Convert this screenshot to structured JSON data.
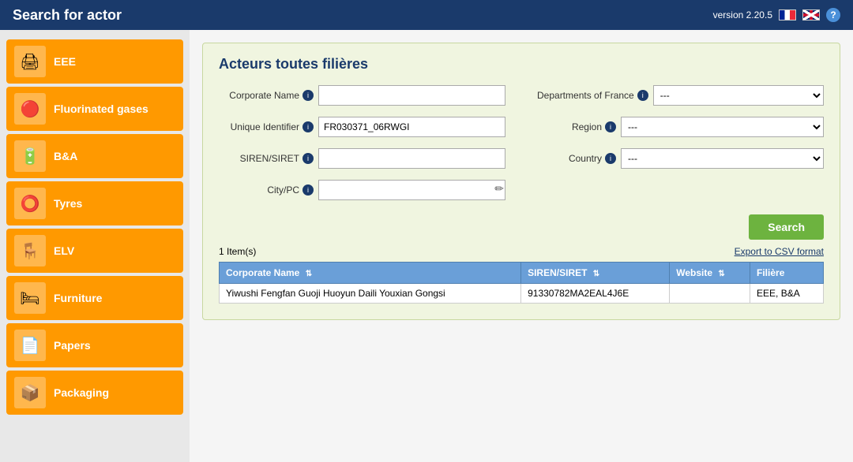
{
  "topbar": {
    "title": "Search for actor",
    "version": "version 2.20.5"
  },
  "sidebar": {
    "items": [
      {
        "id": "eee",
        "label": "EEE",
        "icon": "🖨"
      },
      {
        "id": "fluorinated-gases",
        "label": "Fluorinated gases",
        "icon": "🔴"
      },
      {
        "id": "ba",
        "label": "B&A",
        "icon": "🔋"
      },
      {
        "id": "tyres",
        "label": "Tyres",
        "icon": "⭕"
      },
      {
        "id": "elv",
        "label": "ELV",
        "icon": "🪑"
      },
      {
        "id": "furniture",
        "label": "Furniture",
        "icon": "🛏"
      },
      {
        "id": "papers",
        "label": "Papers",
        "icon": "📄"
      },
      {
        "id": "packaging",
        "label": "Packaging",
        "icon": "📦"
      }
    ]
  },
  "panel": {
    "title": "Acteurs toutes filières",
    "form": {
      "corporate_name_label": "Corporate Name",
      "unique_identifier_label": "Unique Identifier",
      "siren_siret_label": "SIREN/SIRET",
      "city_pc_label": "City/PC",
      "departments_label": "Departments of France",
      "region_label": "Region",
      "country_label": "Country",
      "unique_identifier_value": "FR030371_06RWGI",
      "departments_options": [
        "---"
      ],
      "region_options": [
        "---"
      ],
      "country_options": [
        "---"
      ]
    },
    "search_button": "Search",
    "export_link": "Export to CSV format",
    "results_count": "1 Item(s)",
    "table": {
      "headers": [
        "Corporate Name",
        "SIREN/SIRET",
        "Website",
        "Filière"
      ],
      "rows": [
        {
          "corporate_name": "Yiwushi Fengfan Guoji Huoyun Daili Youxian Gongsi",
          "siren_siret": "91330782MA2EAL4J6E",
          "website": "",
          "filiere": "EEE, B&A"
        }
      ]
    }
  }
}
